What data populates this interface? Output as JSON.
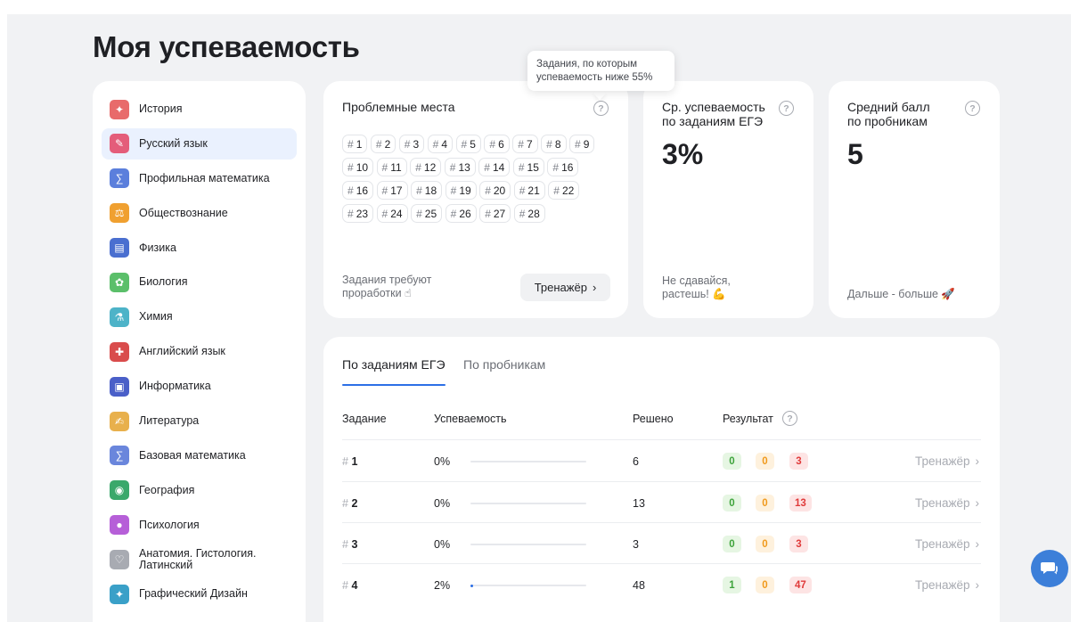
{
  "page": {
    "title": "Моя успеваемость"
  },
  "sidebar": {
    "items": [
      {
        "label": "История",
        "icon": "history-icon",
        "color": "#e86b6b",
        "glyph": "✦"
      },
      {
        "label": "Русский язык",
        "icon": "russian-language-icon",
        "color": "#e45d7a",
        "glyph": "✎",
        "active": true
      },
      {
        "label": "Профильная математика",
        "icon": "math-icon",
        "color": "#5b7fdc",
        "glyph": "∑"
      },
      {
        "label": "Обществознание",
        "icon": "scales-icon",
        "color": "#f0a030",
        "glyph": "⚖"
      },
      {
        "label": "Физика",
        "icon": "physics-icon",
        "color": "#4a6fd0",
        "glyph": "▤"
      },
      {
        "label": "Биология",
        "icon": "biology-icon",
        "color": "#5bbf6a",
        "glyph": "✿"
      },
      {
        "label": "Химия",
        "icon": "chemistry-icon",
        "color": "#4db3c8",
        "glyph": "⚗"
      },
      {
        "label": "Английский язык",
        "icon": "english-flag-icon",
        "color": "#d94c4c",
        "glyph": "✚"
      },
      {
        "label": "Информатика",
        "icon": "computer-icon",
        "color": "#4a5fc8",
        "glyph": "▣"
      },
      {
        "label": "Литература",
        "icon": "literature-icon",
        "color": "#e8b04c",
        "glyph": "✍"
      },
      {
        "label": "Базовая математика",
        "icon": "base-math-icon",
        "color": "#6a86dc",
        "glyph": "∑"
      },
      {
        "label": "География",
        "icon": "globe-icon",
        "color": "#3aa86b",
        "glyph": "◉"
      },
      {
        "label": "Психология",
        "icon": "psychology-icon",
        "color": "#b65fd8",
        "glyph": "●"
      },
      {
        "label": "Анатомия. Гистология. Латинский",
        "icon": "heart-icon",
        "color": "#a8abb2",
        "glyph": "♡"
      },
      {
        "label": "Графический Дизайн",
        "icon": "design-icon",
        "color": "#3aa0c8",
        "glyph": "✦"
      }
    ]
  },
  "problems": {
    "title": "Проблемные места",
    "chips": [
      "1",
      "2",
      "3",
      "4",
      "5",
      "6",
      "7",
      "8",
      "9",
      "10",
      "11",
      "12",
      "13",
      "14",
      "15",
      "16",
      "16",
      "17",
      "18",
      "19",
      "20",
      "21",
      "22",
      "23",
      "24",
      "25",
      "26",
      "27",
      "28"
    ],
    "footer": "Задания требуют проработки ☝",
    "trainer_label": "Тренажёр"
  },
  "tooltip": {
    "text": "Задания, по которым успеваемость ниже 55%"
  },
  "avg_card": {
    "title": "Ср. успеваемость по заданиям ЕГЭ",
    "value": "3%",
    "footer": "Не сдавайся, растешь! 💪"
  },
  "score_card": {
    "title": "Средний балл по пробникам",
    "value": "5",
    "footer": "Дальше - больше 🚀"
  },
  "table": {
    "tabs": [
      "По заданиям ЕГЭ",
      "По пробникам"
    ],
    "headers": {
      "task": "Задание",
      "progress": "Успеваемость",
      "solved": "Решено",
      "result": "Результат"
    },
    "trainer_label": "Тренажёр",
    "rows": [
      {
        "num": "1",
        "percent": "0%",
        "fill": 0,
        "solved": "6",
        "green": "0",
        "orange": "0",
        "red": "3"
      },
      {
        "num": "2",
        "percent": "0%",
        "fill": 0,
        "solved": "13",
        "green": "0",
        "orange": "0",
        "red": "13"
      },
      {
        "num": "3",
        "percent": "0%",
        "fill": 0,
        "solved": "3",
        "green": "0",
        "orange": "0",
        "red": "3"
      },
      {
        "num": "4",
        "percent": "2%",
        "fill": 0.02,
        "solved": "48",
        "green": "1",
        "orange": "0",
        "red": "47"
      }
    ]
  },
  "colors": {
    "accent": "#2c6fe6",
    "green": "#3da33b",
    "orange": "#f0991b",
    "red": "#e03a3a"
  }
}
